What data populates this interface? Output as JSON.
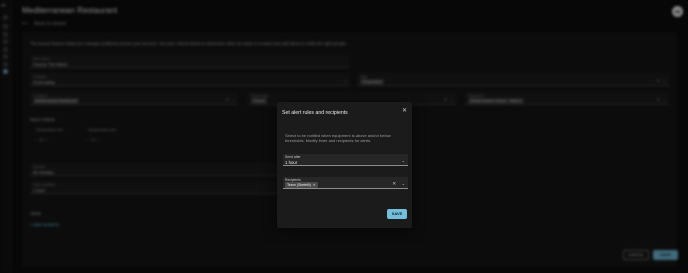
{
  "app": {
    "title": "Mediterranean Restaurant",
    "logo": "cat",
    "avatar_initials": "AB",
    "back_label": "Back to issues",
    "intro": "The issues feature helps you manage problems across your account. Set your criteria below to determine when an issue is created and add alerts to notify the right people.",
    "rail_icons": [
      "home-icon",
      "bell-icon",
      "chart-icon",
      "grid-icon",
      "list-icon",
      "pin-icon",
      "users-icon",
      "issues-icon"
    ]
  },
  "form": {
    "alert_name": {
      "label": "Alert name",
      "value": "Freezer Too Warm"
    },
    "template": {
      "label": "Template",
      "value": "Food safety"
    },
    "tags": {
      "label": "Tags",
      "chip": "Temperature"
    },
    "locations": {
      "label": "Locations",
      "chip": "Mediterranean Restaurant"
    },
    "device_type": {
      "label": "Device type",
      "chip": "Freezer"
    },
    "equipment": {
      "label": "Equipment",
      "chip": "Mediterranean Freezer - Walk-in"
    },
    "issue_criteria": "Issue Criteria",
    "temp_min_label": "Temperature min",
    "temp_max_label": "Temperature max",
    "temp_min_value": "-18",
    "temp_max_value": "-10",
    "duration": {
      "label": "Duration",
      "value": "30 minutes"
    },
    "clear_condition": {
      "label": "Clear condition",
      "value": "1 hour"
    },
    "alerts_heading": "Alerts",
    "add_alerts": "ADD ALERTS",
    "cancel": "CANCEL",
    "save": "SAVE"
  },
  "modal": {
    "title": "Set alert rules and recipients",
    "close_icon": "close-icon",
    "description": "Select to be notified when equipment is above and/or below thresholds. Modify timer and recipients for alerts.",
    "send_after": {
      "label": "Send after",
      "value": "1 hour"
    },
    "recipients": {
      "label": "Recipients",
      "chip": "Team (Sketelli)"
    },
    "save": "SAVE"
  },
  "colors": {
    "accent": "#74bedc",
    "background": "#0d0d0d",
    "modal": "#1b1b1b"
  }
}
